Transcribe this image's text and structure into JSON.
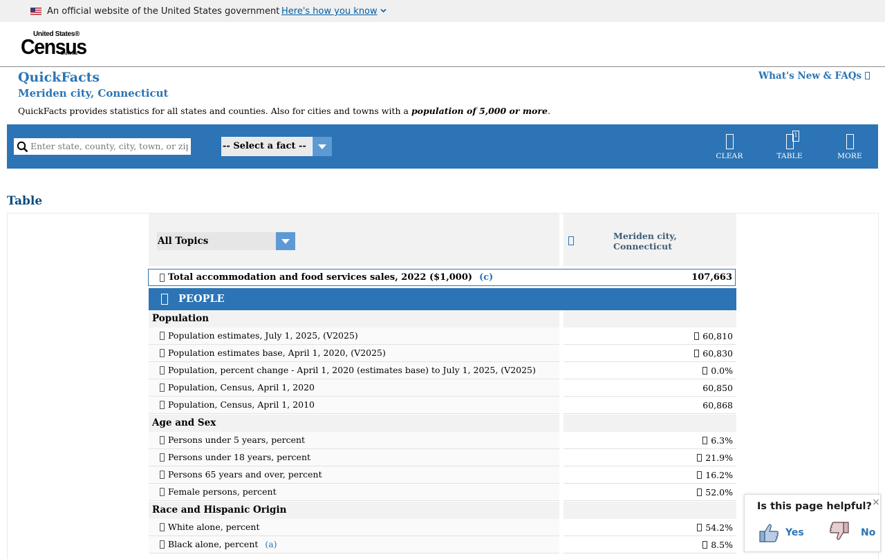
{
  "banner": {
    "official_text": "An official website of the United States government",
    "how_you_know": "Here's how you know"
  },
  "logo": {
    "line1": "United States®",
    "line2": "Census",
    "line3": "Bureau"
  },
  "page": {
    "title": "QuickFacts",
    "subtitle": "Meriden city, Connecticut",
    "description_prefix": "QuickFacts provides statistics for all states and counties. Also for cities and towns with a ",
    "description_emphasis": "population of 5,000 or more",
    "description_suffix": ".",
    "whats_new": "What's New & FAQs"
  },
  "toolbar": {
    "search_placeholder": "Enter state, county, city, town, or zip code",
    "fact_select": "-- Select a fact --",
    "clear_label": "CLEAR",
    "table_label": "TABLE",
    "table_badge": "1",
    "more_label": "MORE"
  },
  "section": {
    "heading": "Table"
  },
  "table": {
    "topics_select": "All Topics",
    "geo_name": "Meriden city, Connecticut",
    "selected": {
      "label": "Total accommodation and food services sales, 2022 ($1,000)",
      "note": "(c)",
      "value": "107,663"
    },
    "people_label": "PEOPLE",
    "groups": [
      {
        "label": "Population"
      },
      {
        "label": "Age and Sex"
      },
      {
        "label": "Race and Hispanic Origin"
      }
    ],
    "rows": [
      {
        "label": "Population estimates, July 1, 2025, (V2025)",
        "value": "60,810",
        "flag": true
      },
      {
        "label": "Population estimates base, April 1, 2020, (V2025)",
        "value": "60,830",
        "flag": true
      },
      {
        "label": "Population, percent change - April 1, 2020 (estimates base) to July 1, 2025, (V2025)",
        "value": "0.0%",
        "flag": true
      },
      {
        "label": "Population, Census, April 1, 2020",
        "value": "60,850",
        "flag": false
      },
      {
        "label": "Population, Census, April 1, 2010",
        "value": "60,868",
        "flag": false
      },
      {
        "label": "Persons under 5 years, percent",
        "value": "6.3%",
        "flag": true
      },
      {
        "label": "Persons under 18 years, percent",
        "value": "21.9%",
        "flag": true
      },
      {
        "label": "Persons 65 years and over, percent",
        "value": "16.2%",
        "flag": true
      },
      {
        "label": "Female persons, percent",
        "value": "52.0%",
        "flag": true
      },
      {
        "label": "White alone, percent",
        "value": "54.2%",
        "flag": true
      },
      {
        "label": "Black alone, percent",
        "note": "(a)",
        "value": "8.5%",
        "flag": true
      }
    ]
  },
  "feedback": {
    "question": "Is this page helpful?",
    "yes": "Yes",
    "no": "No",
    "close": "×"
  },
  "colors": {
    "brand_blue": "#2c74b5",
    "link_blue": "#005ea2",
    "light_blue": "#5d9ad3"
  }
}
